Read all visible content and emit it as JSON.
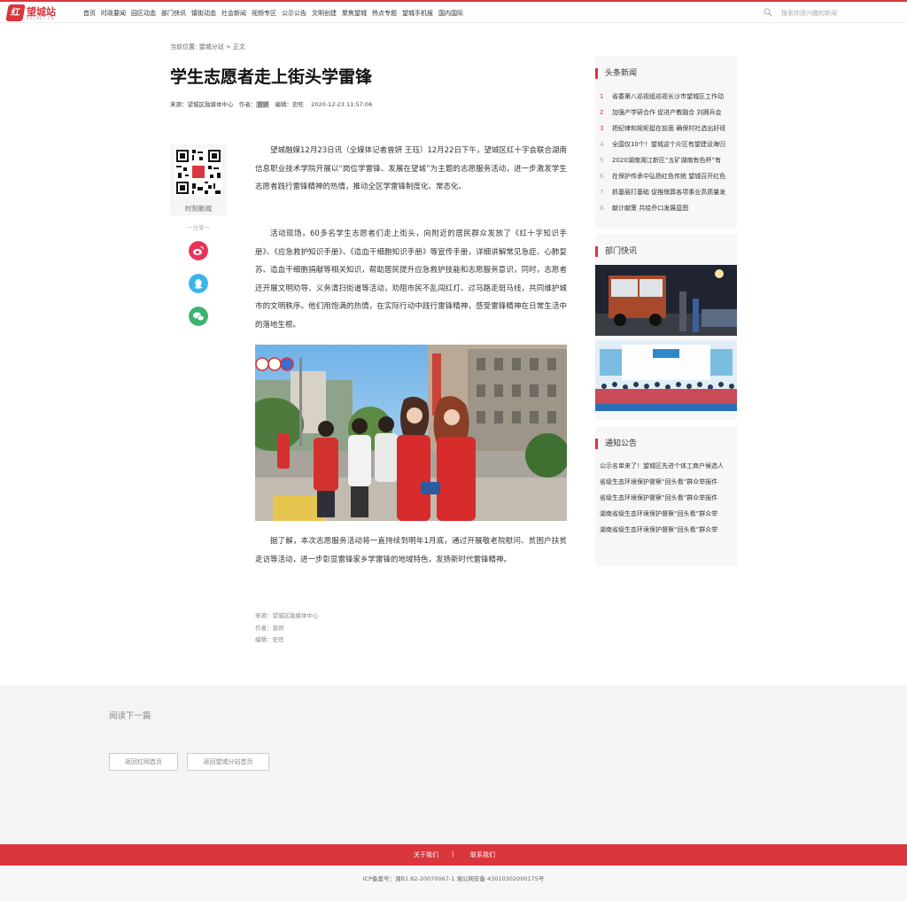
{
  "site": {
    "logo_text": "望城站",
    "logo_sub": "RECNET.CN",
    "logo_mark": "红"
  },
  "nav": [
    "首页",
    "时政要闻",
    "园区动态",
    "部门快讯",
    "镇街动态",
    "社会新闻",
    "视频专区",
    "公示公告",
    "文明创建",
    "聚焦望城",
    "热点专题",
    "望城手机报",
    "国内国际"
  ],
  "search": {
    "placeholder": "搜索你感兴趣的新闻"
  },
  "breadcrumb": "当前位置:  望城分站 > 正文",
  "article": {
    "title": "学生志愿者走上街头学雷锋",
    "meta_source": "来源：望城区融媒体中心",
    "meta_author_label": "作者：",
    "meta_author": "曾妍",
    "meta_editor": "编辑：史旺",
    "meta_time": "2020-12-23 11:57:06",
    "paragraphs": [
      "望城融媒12月23日讯（全媒体记者曾妍 王珏）12月22日下午，望城区红十字会联合湖南信息职业技术学院开展以“岗位学雷锋、发展在望城”为主题的志愿服务活动，进一步激发学生志愿者践行雷锋精神的热情，推动全区学雷锋制度化、常态化。",
      "活动现场，60多名学生志愿者们走上街头，向附近的居民群众发放了《红十字知识手册》、《应急救护知识手册》、《造血干细胞知识手册》等宣传手册，详细讲解常见急症、心肺复苏、造血干细胞捐献等相关知识，帮助居民提升应急救护技能和志愿服务意识，同时，志愿者还开展文明劝导、义务清扫街道等活动，劝阻市民不乱闯红灯、过马路走斑马线，共同维护城市的文明秩序。他们用饱满的热情，在实际行动中践行雷锋精神，感受雷锋精神在日常生活中的落地生根。",
      "据了解，本次志愿服务活动将一直持续到明年1月底，通过开展敬老院慰问、贫困户扶贫走访等活动，进一步彰显雷锋家乡学雷锋的地域特色，发扬新时代雷锋精神。"
    ],
    "footer_source": "来源：望城区融媒体中心",
    "footer_author": "作者：曾妍",
    "footer_editor": "编辑：史旺"
  },
  "share": {
    "qr_label": "时刻新闻",
    "separator": "一分享一",
    "qr_badge": "时刻"
  },
  "sidebar": {
    "headlines_title": "头条新闻",
    "headlines": [
      {
        "num": "1",
        "text": "省委第八巡视组巡视长沙市望城区工作动"
      },
      {
        "num": "2",
        "text": "加强产学研合作 促进产教融合 刘拥兵会"
      },
      {
        "num": "3",
        "text": "把纪律和规矩挺在前面 确保村社选出好班"
      },
      {
        "num": "4",
        "text": "全国仅10个！望城这个片区有望建设海归"
      },
      {
        "num": "5",
        "text": "2020湖南湘江新区“五矿湖南有色杯”有"
      },
      {
        "num": "6",
        "text": "在保护传承中弘扬红色传统 望城召开红色"
      },
      {
        "num": "7",
        "text": "抓基层打基础 促推殡葬各项事业高质量发"
      },
      {
        "num": "8",
        "text": "献计献策 共绘乔口发展蓝图"
      }
    ],
    "dept_title": "部门快讯",
    "notice_title": "通知公告",
    "notices": [
      "公示名单来了！望城区先进个体工商户候选人",
      "省级生态环境保护督察“回头看”群众举报件",
      "省级生态环境保护督察“回头看”群众举报件",
      "湖南省级生态环境保护督察“回头看”群众举",
      "湖南省级生态环境保护督察“回头看”群众举"
    ]
  },
  "read_next": {
    "title": "阅读下一篇",
    "btn_home": "返回红网首页",
    "btn_branch": "返回望城分站首页"
  },
  "footer": {
    "about": "关于我们",
    "divider": "|",
    "contact": "联系我们",
    "icp": "ICP备案号：湘B1.82-20070067-1 湘公网安备 43010302000175号"
  },
  "colors": {
    "brand_red": "#d9363e",
    "weibo": "#e6335a",
    "qq": "#3ab4ea",
    "wechat": "#3cb371"
  }
}
